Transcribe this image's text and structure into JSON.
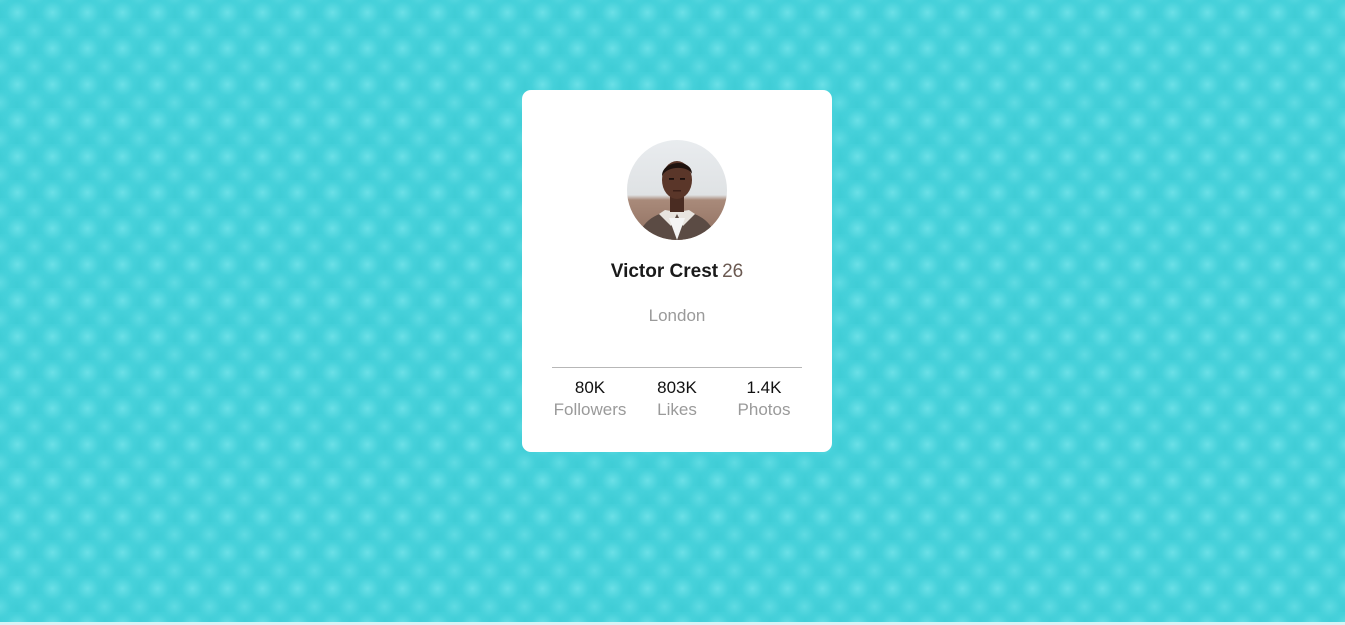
{
  "card": {
    "name": "Victor Crest",
    "age": "26",
    "city": "London",
    "stats": [
      {
        "value": "80K",
        "label": "Followers"
      },
      {
        "value": "803K",
        "label": "Likes"
      },
      {
        "value": "1.4K",
        "label": "Photos"
      }
    ]
  },
  "colors": {
    "background": "#3fcdd6",
    "card": "#ffffff",
    "muted_text": "#9a9a9a",
    "age_text": "#6b5a52"
  },
  "icons": {
    "avatar": "profile-photo"
  }
}
